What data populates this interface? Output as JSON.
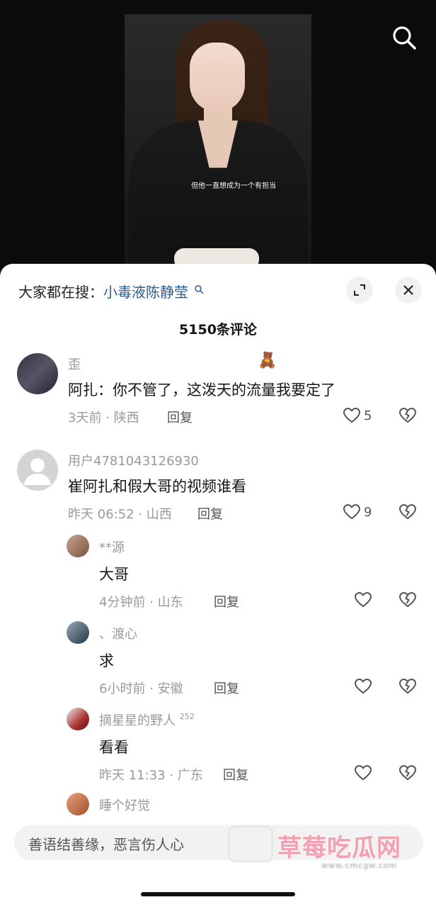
{
  "video": {
    "subtitle": "但他一直想成为一个有担当"
  },
  "header": {
    "hot_prefix": "大家都在搜：",
    "hot_term": "小毒液陈静莹",
    "comment_count": "5150条评论"
  },
  "comments": [
    {
      "user": "歪",
      "text": "阿扎：你不管了，这泼天的流量我要定了",
      "meta": "3天前 · 陕西",
      "reply": "回复",
      "likes": "5",
      "emoji": "🧸"
    },
    {
      "user": "用户4781043126930",
      "text": "崔阿扎和假大哥的视频谁看",
      "meta": "昨天 06:52 · 山西",
      "reply": "回复",
      "likes": "9"
    }
  ],
  "replies": [
    {
      "user": "**源",
      "text": "大哥",
      "meta": "4分钟前 · 山东",
      "reply": "回复"
    },
    {
      "user": "、渡心",
      "text": "求",
      "meta": "6小时前 · 安徽",
      "reply": "回复"
    },
    {
      "user": "摘星星的野人",
      "badge": "252",
      "text": "看看",
      "meta": "昨天 11:33 · 广东",
      "reply": "回复"
    },
    {
      "user": "睡个好觉"
    }
  ],
  "input": {
    "placeholder": "善语结善缘，恶言伤人心"
  },
  "watermark": {
    "name": "草莓吃瓜网",
    "url": "www.cmcgw.com"
  },
  "colors": {
    "link": "#2b5c91",
    "muted": "#9a9a9a",
    "text": "#161616"
  }
}
